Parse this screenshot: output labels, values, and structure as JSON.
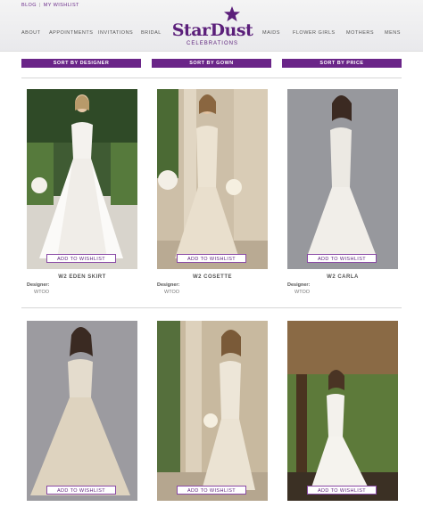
{
  "header": {
    "util_links": [
      "BLOG",
      "MY WISHLIST"
    ],
    "nav_left": [
      "ABOUT",
      "APPOINTMENTS",
      "INVITATIONS",
      "BRIDAL"
    ],
    "nav_right": [
      "MAIDS",
      "FLOWER GIRLS",
      "MOTHERS",
      "MENS"
    ],
    "logo_text": "StarDust",
    "logo_sub": "CELEBRATIONS"
  },
  "sort_buttons": [
    "SORT BY DESIGNER",
    "SORT BY GOWN",
    "SORT BY PRICE"
  ],
  "products": [
    {
      "name": "W2 EDEN SKIRT",
      "designer_label": "Designer:",
      "designer": "WTOO",
      "wishlist": "ADD TO WISHLIST"
    },
    {
      "name": "W2 COSETTE",
      "designer_label": "Designer:",
      "designer": "WTOO",
      "wishlist": "ADD TO WISHLIST"
    },
    {
      "name": "W2 CARLA",
      "designer_label": "Designer:",
      "designer": "WTOO",
      "wishlist": "ADD TO WISHLIST"
    },
    {
      "name": "",
      "designer_label": "",
      "designer": "",
      "wishlist": "ADD TO WISHLIST"
    },
    {
      "name": "",
      "designer_label": "",
      "designer": "",
      "wishlist": "ADD TO WISHLIST"
    },
    {
      "name": "",
      "designer_label": "",
      "designer": "",
      "wishlist": "ADD TO WISHLIST"
    }
  ],
  "colors": {
    "brand_purple": "#6a2588",
    "logo_purple": "#5b1f7a",
    "header_bg": "#efeff1"
  },
  "icons": [
    "star-logo-icon"
  ]
}
